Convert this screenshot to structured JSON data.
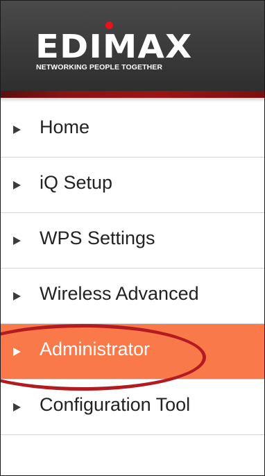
{
  "brand": {
    "name": "EDIMAX",
    "tagline": "NETWORKING PEOPLE TOGETHER",
    "colors": {
      "header": "#3a3a3a",
      "accent_red": "#e3141b",
      "active_item": "#f9794a",
      "highlight_ring": "#b31b20"
    }
  },
  "menu": {
    "active_index": 4,
    "items": [
      {
        "label": "Home",
        "icon": "triangle-right-icon"
      },
      {
        "label": "iQ Setup",
        "icon": "triangle-right-icon"
      },
      {
        "label": "WPS Settings",
        "icon": "triangle-right-icon"
      },
      {
        "label": "Wireless Advanced",
        "icon": "triangle-right-icon"
      },
      {
        "label": "Administrator",
        "icon": "triangle-right-icon"
      },
      {
        "label": "Configuration Tool",
        "icon": "triangle-right-icon"
      }
    ]
  }
}
